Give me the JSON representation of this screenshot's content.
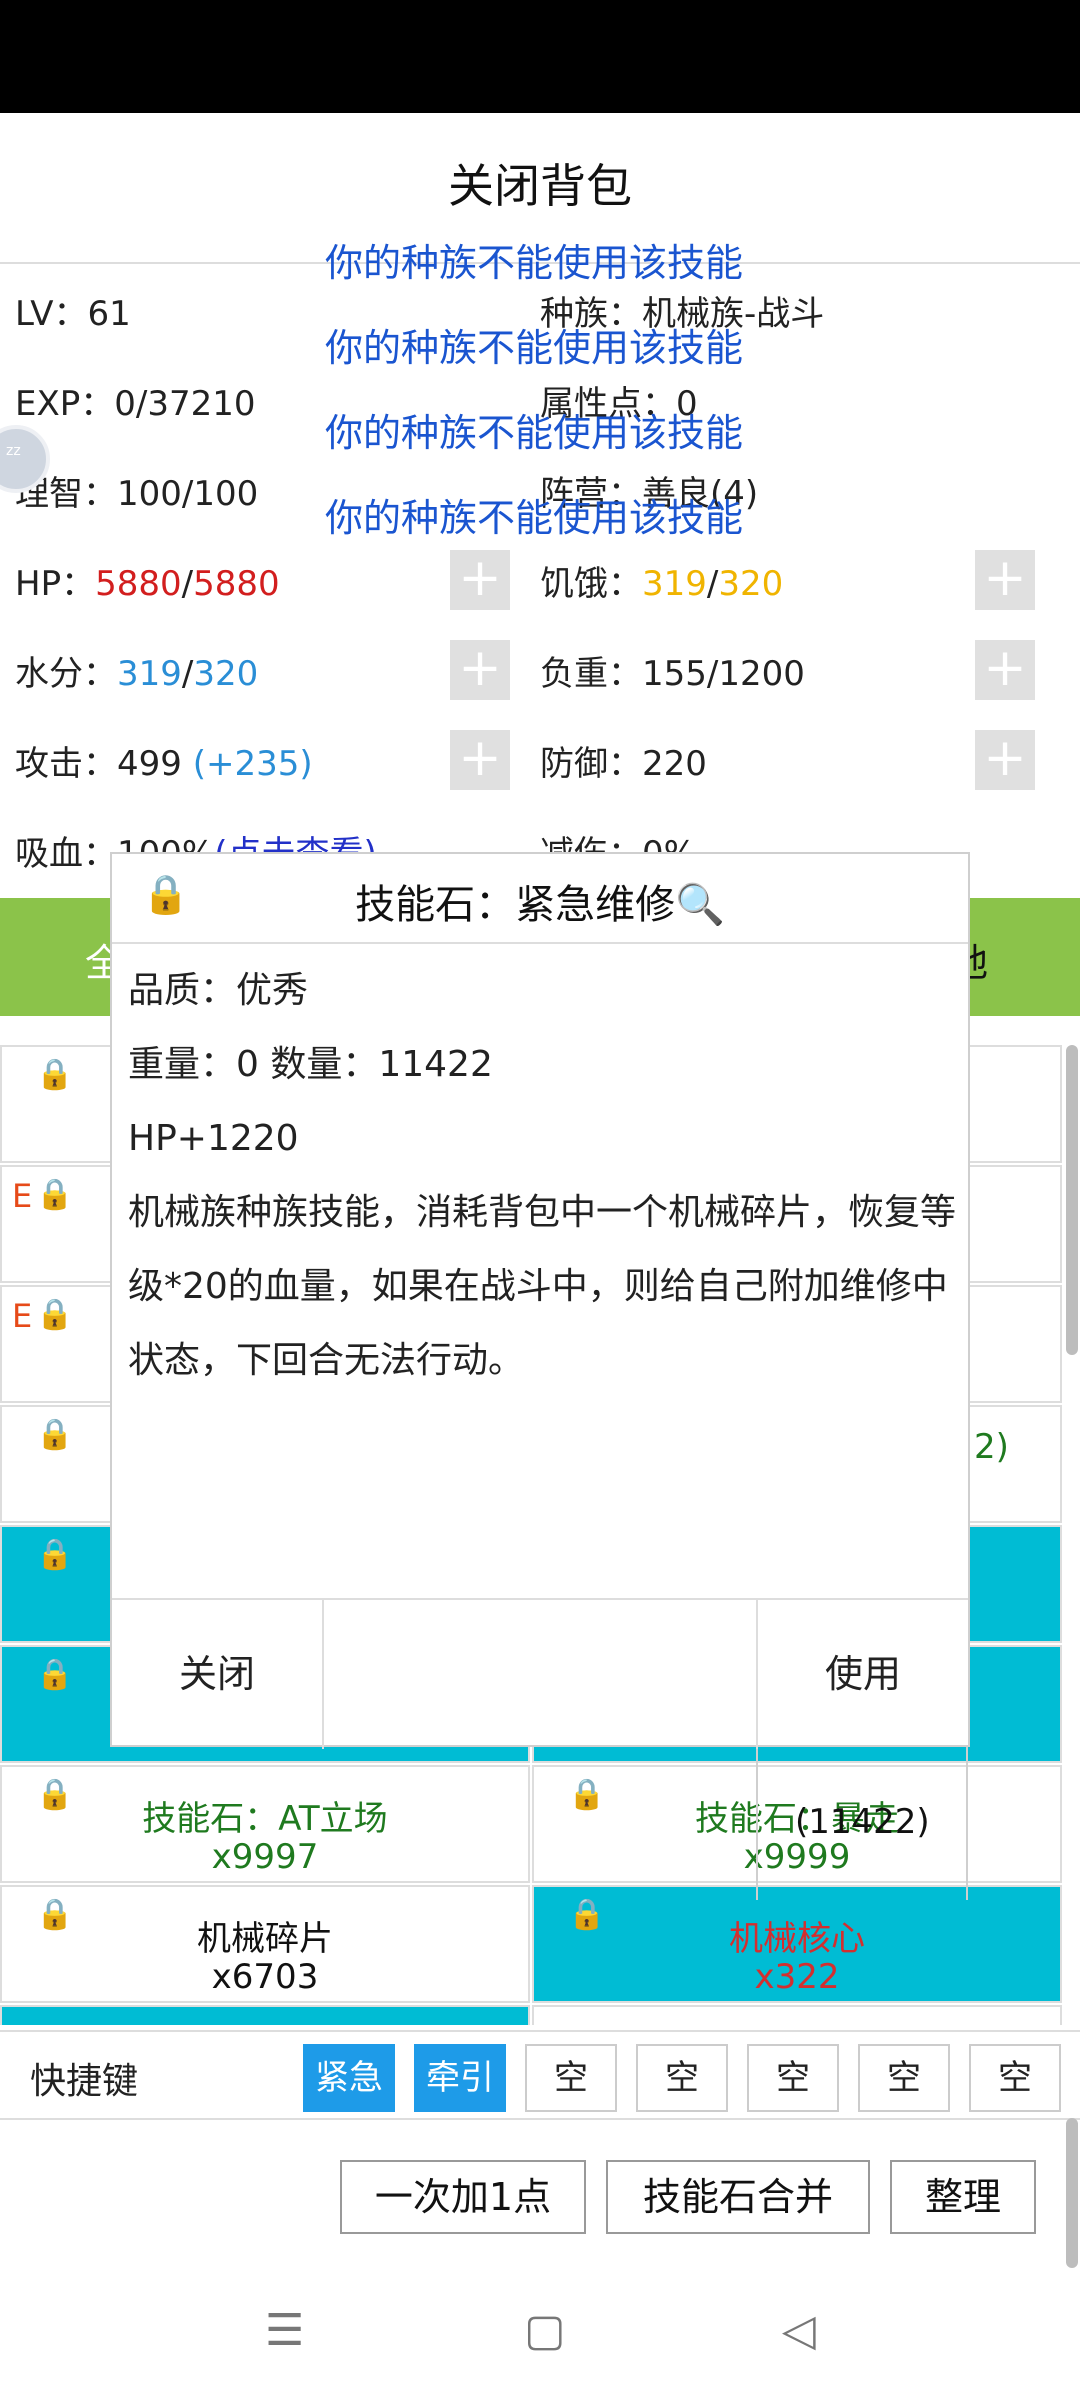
{
  "header": {
    "title": "关闭背包"
  },
  "toasts": [
    "你的种族不能使用该技能",
    "你的种族不能使用该技能",
    "你的种族不能使用该技能",
    "你的种族不能使用该技能"
  ],
  "stats": {
    "lv_label": "LV：",
    "lv": "61",
    "race_label": "种族：",
    "race": "机械族-战斗",
    "exp_label": "EXP：",
    "exp": "0/37210",
    "points_label": "属性点：",
    "points": "0",
    "sanity_label": "理智：",
    "sanity": "100/100",
    "camp_label": "阵营：",
    "camp": "善良(4)",
    "hp_label": "HP：",
    "hp_cur": "5880",
    "hp_max": "5880",
    "hunger_label": "饥饿：",
    "hunger_cur": "319",
    "hunger_max": "320",
    "water_label": "水分：",
    "water_cur": "319",
    "water_max": "320",
    "load_label": "负重：",
    "load": "155/1200",
    "atk_label": "攻击：",
    "atk": "499",
    "atk_bonus": "(+235)",
    "def_label": "防御：",
    "def": "220",
    "lifesteal_label": "吸血：",
    "lifesteal": "100%",
    "lifesteal_link": "(点击查看)",
    "dmgred_label": "减伤：",
    "dmgred": "0%",
    "sep": "/",
    "plus": "+"
  },
  "tabs": {
    "left_partial": "全",
    "right_partial": "他"
  },
  "inventory": [
    {
      "name": "技能石：AT立场",
      "count": "x9997",
      "color": "green",
      "cyan": false
    },
    {
      "name": "技能石：暴走",
      "count": "x9999",
      "color": "green",
      "cyan": false
    },
    {
      "name": "机械碎片",
      "count": "x6703",
      "color": "black",
      "cyan": false
    },
    {
      "name": "机械核心",
      "count": "x322",
      "color": "red",
      "cyan": true
    }
  ],
  "partials": {
    "row4_right": "2)",
    "tooltip_count": "(11422)",
    "e_mark": "E"
  },
  "modal": {
    "title": "技能石：紧急维修🔍",
    "quality": "品质：优秀",
    "weight_count": "重量：0  数量：11422",
    "effect": "HP+1220",
    "desc": "机械族种族技能，消耗背包中一个机械碎片，恢复等级*20的血量，如果在战斗中，则给自己附加维修中状态，下回合无法行动。",
    "close_label": "关闭",
    "use_label": "使用"
  },
  "quickbar": {
    "label": "快捷键",
    "slots": [
      "紧急",
      "牵引",
      "空",
      "空",
      "空",
      "空",
      "空"
    ]
  },
  "actions": {
    "add_one": "一次加1点",
    "merge": "技能石合并",
    "sort": "整理"
  },
  "icons": {
    "lock": "🔒",
    "menu": "☰",
    "home": "▢",
    "back": "◁"
  },
  "colors": {
    "accent_blue": "#1e9be8",
    "cyan": "#00bcd4",
    "green_bar": "#8bc34a"
  }
}
